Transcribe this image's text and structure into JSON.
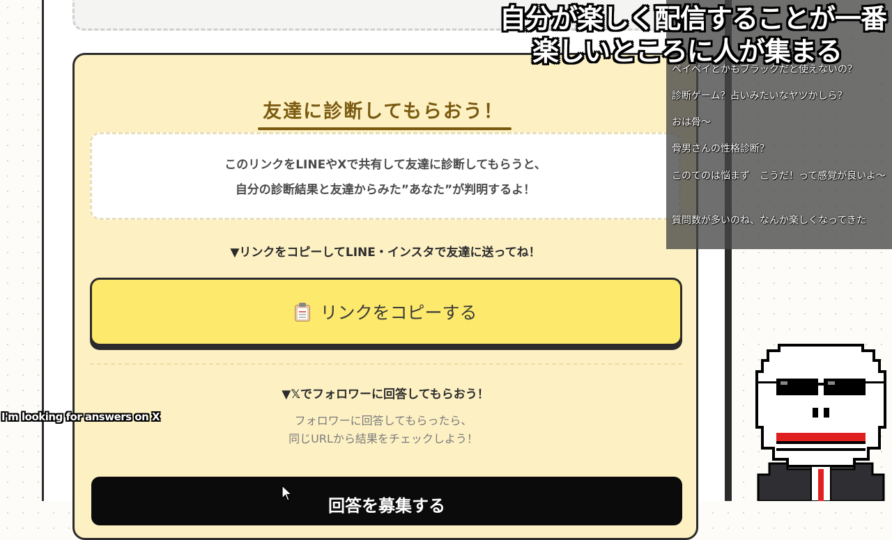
{
  "stream_caption": {
    "line1": "自分が楽しく配信することが一番",
    "line2": "楽しいところに人が集まる"
  },
  "subtitle_en": "I'm looking for answers on X",
  "card": {
    "title": "友達に診断してもらおう！",
    "explain_line1": "このリンクをLINEやXで共有して友達に診断してもらうと、",
    "explain_line2": "自分の診断結果と友達からみた”あなた”が判明するよ！",
    "instruction_copy": "▼リンクをコピーしてLINE・インスタで友達に送ってね！",
    "copy_button_label": "リンクをコピーする",
    "copy_button_icon": "clipboard-icon",
    "instruction_x": "▼𝕏でフォロワーに回答してもらおう！",
    "note_line1": "フォロワーに回答してもらったら、",
    "note_line2": "同じURLから結果をチェックしよう！",
    "x_button_label": "回答を募集する",
    "accent_color": "#7a5a10",
    "button_color": "#fde96b"
  },
  "chat": {
    "messages": [
      "ペイペイとかもブラックだと使えないの？",
      "診断ゲーム？占いみたいなヤツかしら？",
      "おは骨～",
      "骨男さんの性格診断？",
      "このてのは悩まず　こうだ！って感覚が良いよ～",
      "質問数が多いのね、なんか楽しくなってきた"
    ]
  }
}
